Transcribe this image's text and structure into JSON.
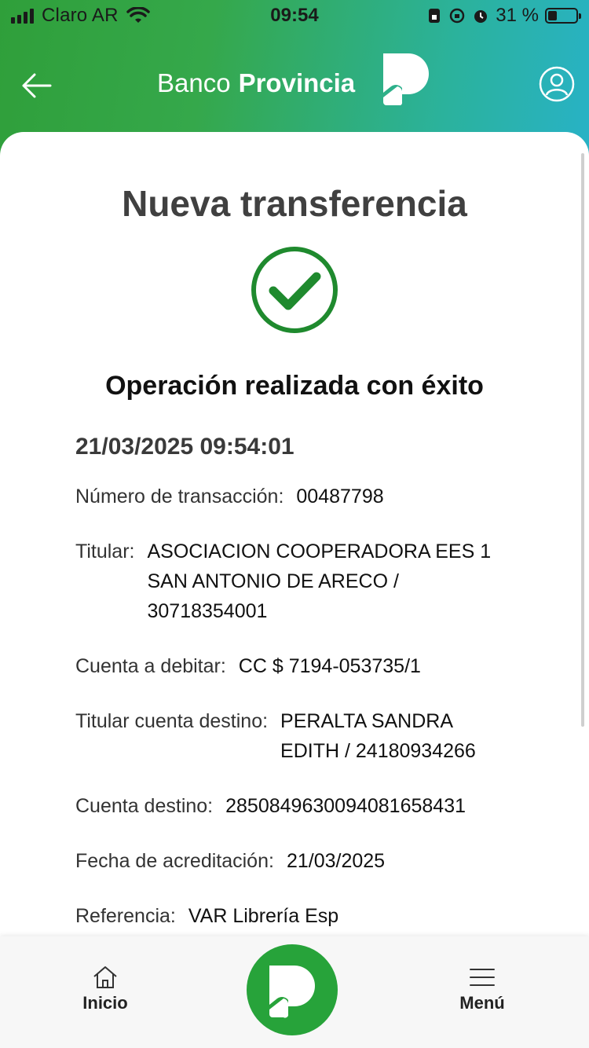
{
  "status_bar": {
    "carrier": "Claro AR",
    "time": "09:54",
    "battery_percent": "31 %",
    "battery_level": 0.31
  },
  "header": {
    "brand_light": "Banco",
    "brand_bold": "Provincia",
    "icons": {
      "back": "arrow-left-icon",
      "logo": "banco-provincia-logo",
      "user": "user-profile-icon"
    },
    "gradient_colors": [
      "#2f9f3a",
      "#28b2c6"
    ]
  },
  "page": {
    "title": "Nueva transferencia",
    "success_message": "Operación realizada con éxito",
    "datetime": "21/03/2025 09:54:01",
    "accent_color": "#1f8a2e"
  },
  "details": {
    "transaction_number": {
      "label": "Número de transacción:",
      "value": "00487798"
    },
    "holder": {
      "label": "Titular:",
      "lines": [
        "ASOCIACION COOPERADORA EES 1",
        "SAN ANTONIO DE ARECO /",
        "30718354001"
      ]
    },
    "debit_account": {
      "label": "Cuenta a debitar:",
      "value": "CC $ 7194-053735/1"
    },
    "destination_holder": {
      "label": "Titular cuenta destino:",
      "lines": [
        "PERALTA SANDRA",
        "EDITH / 24180934266"
      ]
    },
    "destination_account": {
      "label": "Cuenta destino:",
      "value": "2850849630094081658431"
    },
    "credit_date": {
      "label": "Fecha de acreditación:",
      "value": "21/03/2025"
    },
    "reference": {
      "label": "Referencia:",
      "value": "VAR Librería Esp"
    }
  },
  "bottom_nav": {
    "home_label": "Inicio",
    "menu_label": "Menú",
    "icons": {
      "home": "home-icon",
      "center": "provincia-logo-button",
      "menu": "hamburger-menu-icon"
    },
    "fab_color": "#27a33a"
  }
}
